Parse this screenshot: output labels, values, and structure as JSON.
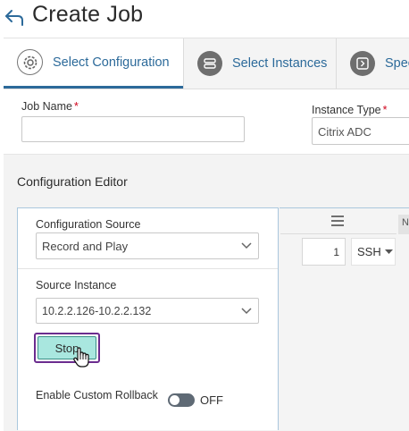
{
  "page": {
    "title": "Create Job"
  },
  "steps": [
    {
      "label": "Select Configuration",
      "icon": "gear-icon",
      "active": true
    },
    {
      "label": "Select Instances",
      "icon": "instances-icon",
      "active": false
    },
    {
      "label": "Spec",
      "icon": "specify-icon",
      "active": false
    }
  ],
  "form": {
    "job_name": {
      "label": "Job Name",
      "required_mark": "*",
      "value": ""
    },
    "instance_type": {
      "label": "Instance Type",
      "required_mark": "*",
      "value": "Citrix ADC"
    }
  },
  "editor": {
    "title": "Configuration Editor",
    "config_source": {
      "label": "Configuration Source",
      "value": "Record and Play"
    },
    "source_instance": {
      "label": "Source Instance",
      "value": "10.2.2.126-10.2.2.132"
    },
    "stop_label": "Stop",
    "rollback": {
      "label": "Enable Custom Rollback",
      "state": "OFF"
    }
  },
  "right_panel": {
    "tab_label": "N",
    "line_number": "1",
    "protocol": "SSH"
  },
  "colors": {
    "accent": "#2c6a9a",
    "stop_fill": "#a9e7df",
    "focus_ring": "#6b2c8f",
    "required": "#d0021b"
  }
}
